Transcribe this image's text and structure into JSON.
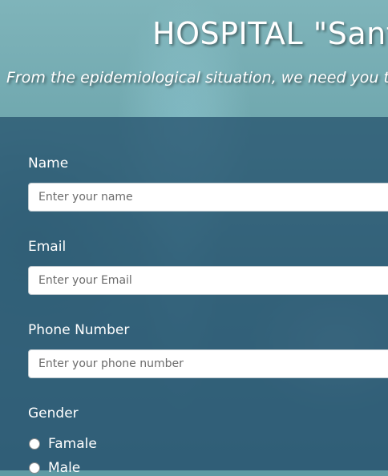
{
  "header": {
    "title": "HOSPITAL \"Sant",
    "subtitle": "From the epidemiological situation, we need you t"
  },
  "form": {
    "name": {
      "label": "Name",
      "placeholder": "Enter your name"
    },
    "email": {
      "label": "Email",
      "placeholder": "Enter your Email"
    },
    "phone": {
      "label": "Phone Number",
      "placeholder": "Enter your phone number"
    },
    "gender": {
      "label": "Gender",
      "options": [
        "Famale",
        "Male"
      ]
    }
  },
  "colors": {
    "panel_overlay": "#28557099",
    "text": "#ffffff"
  }
}
